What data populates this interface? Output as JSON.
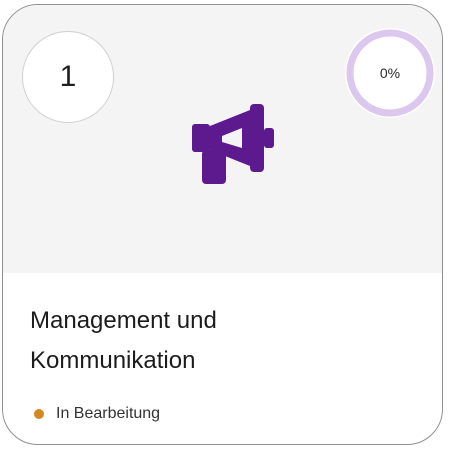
{
  "card": {
    "number": "1",
    "progress": {
      "label": "0%",
      "value": 0,
      "ring_color": "#dcc7ef"
    },
    "icon": "megaphone-icon",
    "icon_color": "#5c1a8e",
    "title_line1": "Management und",
    "title_line2": "Kommunikation",
    "status": {
      "label": "In Bearbeitung",
      "color": "#d4891f"
    }
  }
}
